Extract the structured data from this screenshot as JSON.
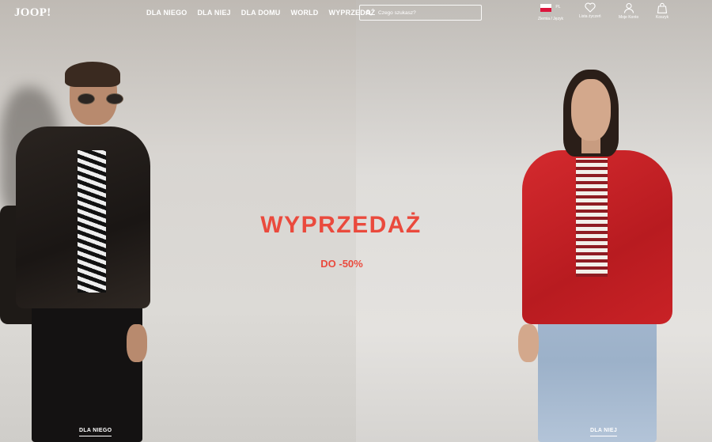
{
  "header": {
    "logo": "JOOP!",
    "nav": [
      "DLA NIEGO",
      "DLA NIEJ",
      "DLA DOMU",
      "WORLD",
      "WYPRZEDAŻ"
    ],
    "search": {
      "placeholder": "Czego szukasz?"
    },
    "utilities": {
      "country_language": {
        "label": "Ziemia / Język",
        "lang_code": "PL",
        "flag_colors": [
          "#ffffff",
          "#dc143c"
        ]
      },
      "wishlist": {
        "label": "Lista życzeń",
        "icon": "heart-icon"
      },
      "account": {
        "label": "Moje Konto",
        "icon": "user-icon"
      },
      "cart": {
        "label": "Koszyk",
        "icon": "bag-icon"
      }
    }
  },
  "promo": {
    "title": "WYPRZEDAŻ",
    "subtitle": "DO -50%",
    "color": "#ea4a3d"
  },
  "hero_links": {
    "left": "DLA NIEGO",
    "right": "DLA NIEJ"
  }
}
